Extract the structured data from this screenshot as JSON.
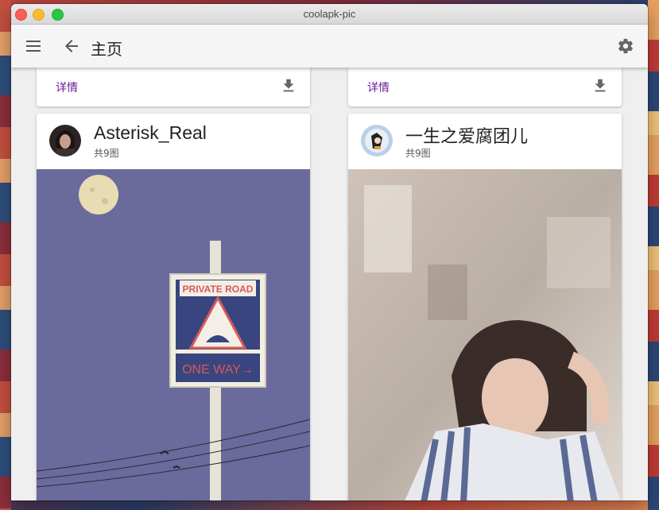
{
  "window": {
    "title": "coolapk-pic"
  },
  "appbar": {
    "title": "主页",
    "menu_icon": "menu-icon",
    "back_icon": "arrow-back-icon",
    "settings_icon": "gear-icon"
  },
  "colors": {
    "link": "#6a1b9a",
    "appbar_bg": "#f5f5f5"
  },
  "cards": {
    "top_left": {
      "detail": "详情",
      "icon": "download-icon"
    },
    "top_right": {
      "detail": "详情",
      "icon": "download-icon"
    },
    "post_left": {
      "author": "Asterisk_Real",
      "count": "共9图",
      "sign_line1": "PRIVATE ROAD",
      "sign_line2": "ONE WAY→"
    },
    "post_right": {
      "author": "一生之爱腐团儿",
      "count": "共9图"
    }
  }
}
